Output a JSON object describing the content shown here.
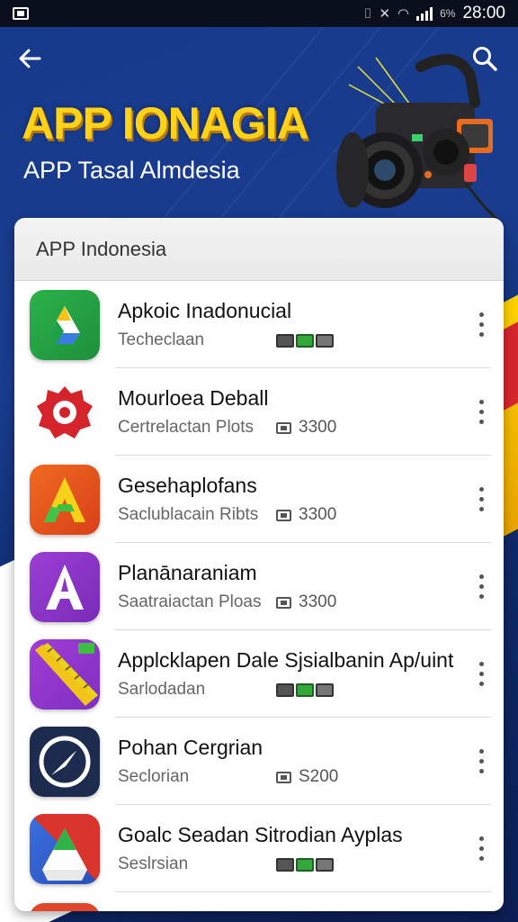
{
  "status_bar": {
    "time": "28:00",
    "battery": "6%"
  },
  "header": {
    "back_icon": "back-arrow-icon",
    "search_icon": "search-icon",
    "title": "APP IONAGIA",
    "subtitle": "APP Tasal Almdesia"
  },
  "card": {
    "heading": "APP Indonesia",
    "apps": [
      {
        "name": "Apkoic Inadonucial",
        "sub": "Techeclaan",
        "extra_type": "badges",
        "size": "",
        "icon": "drive-icon"
      },
      {
        "name": "Mourloea Deball",
        "sub": "Certrelactan Plots",
        "extra_type": "size",
        "size": "3300",
        "icon": "red-gear-icon"
      },
      {
        "name": "Gesehaplofans",
        "sub": "Saclublacain Ribts",
        "extra_type": "size",
        "size": "3300",
        "icon": "letter-a-orange-icon"
      },
      {
        "name": "Planānaraniam",
        "sub": "Saatraiactan Ploas",
        "extra_type": "size",
        "size": "3300",
        "icon": "letter-a-purple-icon"
      },
      {
        "name": "Applcklapen Dale Sjsialbanin Ap/uint",
        "sub": "Sarlodadan",
        "extra_type": "badges",
        "size": "",
        "icon": "ruler-icon"
      },
      {
        "name": "Pohan Cergrian",
        "sub": "Seclorian",
        "extra_type": "size",
        "size": "S200",
        "icon": "compass-icon"
      },
      {
        "name": "Goalc Seadan Sitrodian Ayplas",
        "sub": "Seslrsian",
        "extra_type": "badges",
        "size": "",
        "icon": "triangle-logo-icon"
      }
    ]
  },
  "colors": {
    "title_yellow": "#ffd21a",
    "background_blue": "#163a8c",
    "accent_yellow": "#ffd400",
    "accent_red": "#d6262d"
  }
}
